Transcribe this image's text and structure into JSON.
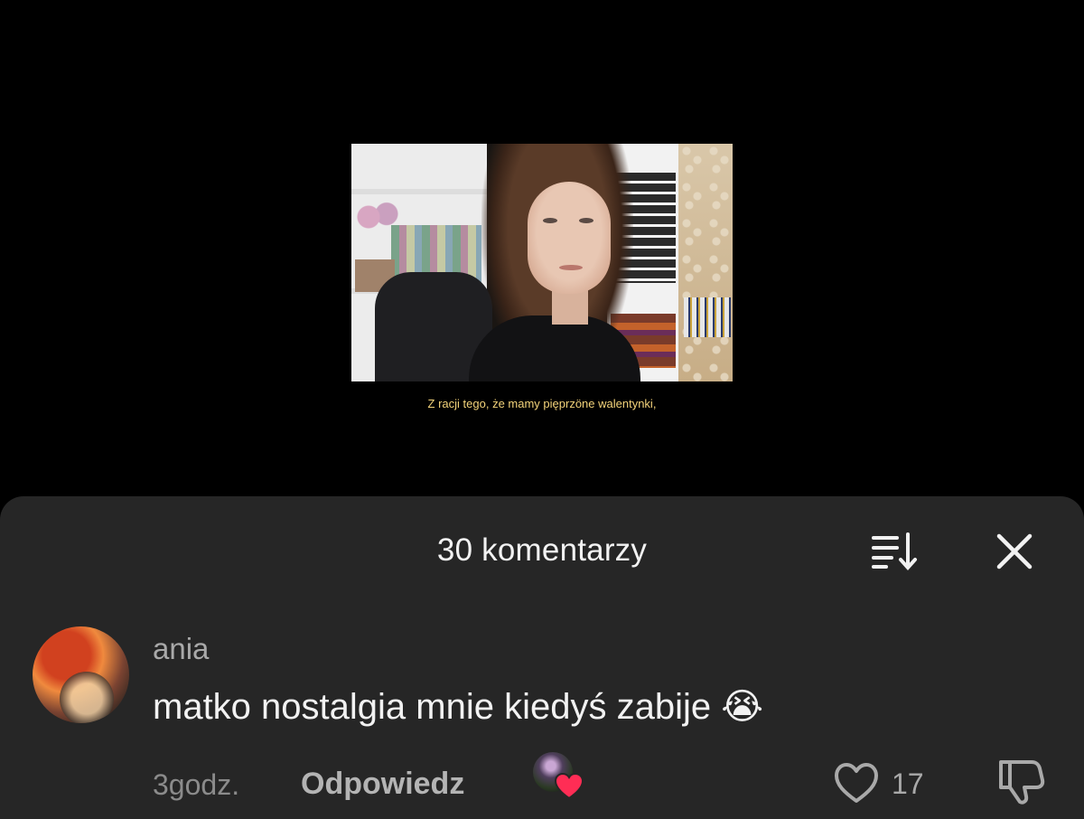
{
  "video": {
    "subtitle": "Z racji tego, że mamy pięprzöne walentynki,"
  },
  "comments_panel": {
    "title": "30 komentarzy",
    "sort_icon": "sort-icon",
    "close_icon": "close-icon"
  },
  "comment": {
    "username": "ania",
    "text": "matko nostalgia mnie kiedyś zabije",
    "emoji": "😭",
    "time": "3godz.",
    "reply_label": "Odpowiedz",
    "likes": "17",
    "creator_liked": true
  },
  "colors": {
    "sheet_bg": "#262626",
    "subtitle": "#f3d37a",
    "heart": "#ff2d55"
  }
}
